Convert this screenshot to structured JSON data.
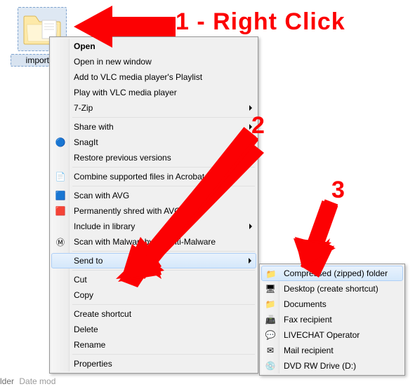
{
  "folder": {
    "label": "importan"
  },
  "statusbar": {
    "prefix": "lder",
    "date_label": "Date mod"
  },
  "annotations": {
    "step1": "1 - Right Click",
    "step2": "2",
    "step3": "3"
  },
  "context_menu": {
    "open": "Open",
    "open_new_window": "Open in new window",
    "add_vlc_playlist": "Add to VLC media player's Playlist",
    "play_vlc": "Play with VLC media player",
    "seven_zip": "7-Zip",
    "share_with": "Share with",
    "snagit": "SnagIt",
    "restore_versions": "Restore previous versions",
    "combine_acrobat": "Combine supported files in Acrobat...",
    "scan_avg": "Scan with AVG",
    "shred_avg": "Permanently shred with AVG",
    "include_library": "Include in library",
    "scan_malwarebytes": "Scan with Malwarebytes Anti-Malware",
    "send_to": "Send to",
    "cut": "Cut",
    "copy": "Copy",
    "create_shortcut": "Create shortcut",
    "delete": "Delete",
    "rename": "Rename",
    "properties": "Properties"
  },
  "send_to_menu": {
    "compressed": "Compressed (zipped) folder",
    "desktop_shortcut": "Desktop (create shortcut)",
    "documents": "Documents",
    "fax": "Fax recipient",
    "livechat": "LIVECHAT Operator",
    "mail": "Mail recipient",
    "dvd_drive": "DVD RW Drive (D:)"
  },
  "icons": {
    "snagit": "🔵",
    "acrobat": "📄",
    "avg_scan": "🟦",
    "avg_shred": "🟥",
    "malwarebytes": "Ⓜ",
    "zip": "📁",
    "desktop": "🖥",
    "documents": "📁",
    "fax": "📠",
    "livechat": "💬",
    "mail": "✉",
    "dvd": "💿"
  }
}
